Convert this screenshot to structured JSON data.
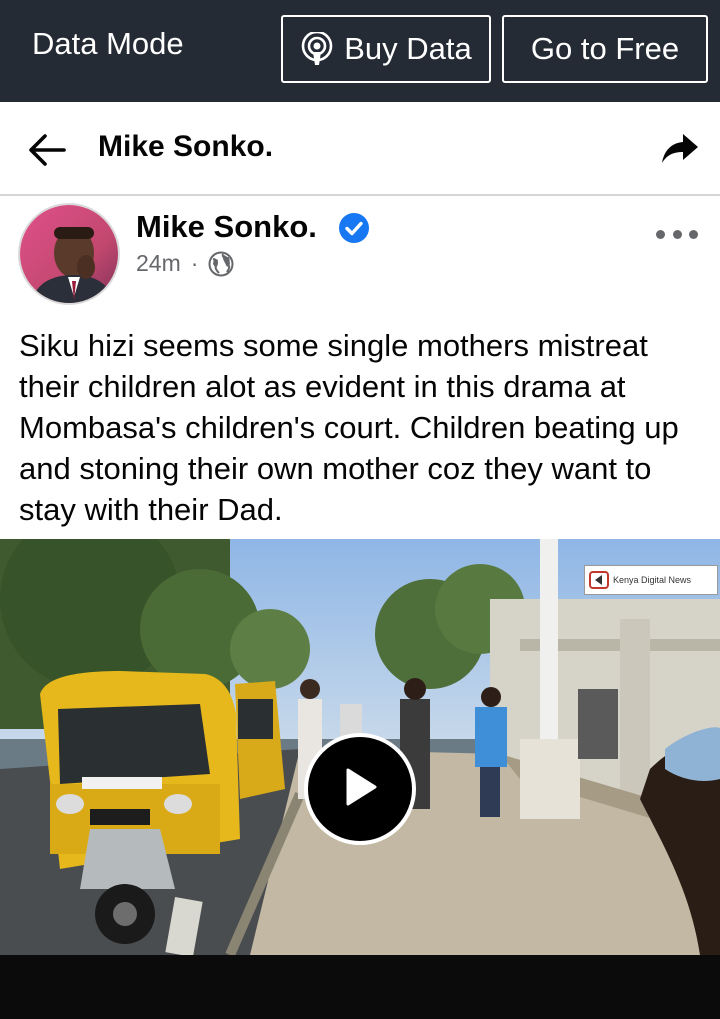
{
  "data_bar": {
    "mode_label": "Data Mode",
    "buy_data_label": "Buy Data",
    "go_free_label": "Go to Free"
  },
  "header": {
    "title": "Mike Sonko."
  },
  "post": {
    "author": "Mike Sonko.",
    "time": "24m",
    "separator": "·",
    "text": "Siku hizi seems some single mothers mistreat their children alot as evident in this drama at Mombasa's children's court. Children beating up and stoning their own mother coz they want to stay with their Dad."
  },
  "video": {
    "watermark": "Kenya Digital News"
  },
  "icons": {
    "back": "arrow-left-icon",
    "share": "share-arrow-icon",
    "verified": "verified-badge-icon",
    "globe": "globe-icon",
    "more": "more-dots-icon",
    "play": "play-icon",
    "podcast": "podcast-icon"
  },
  "colors": {
    "data_bar_bg": "#252b34",
    "verified_blue": "#1877f2",
    "meta_gray": "#65676b"
  }
}
